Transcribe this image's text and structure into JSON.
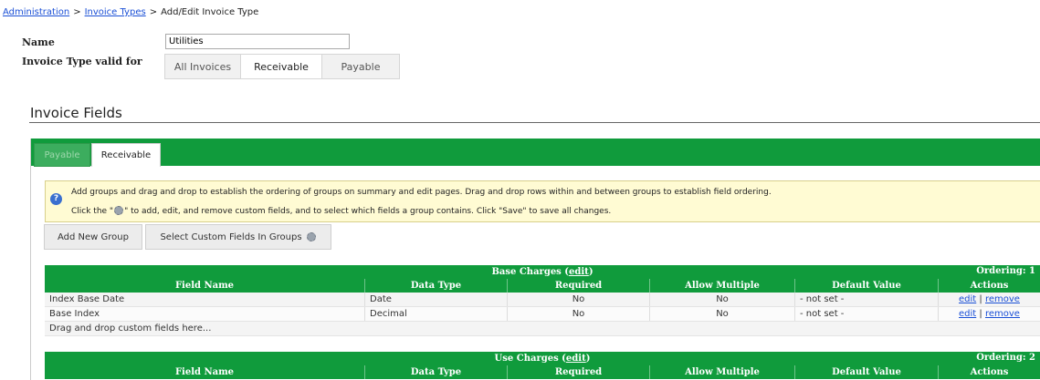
{
  "breadcrumb": {
    "items": [
      "Administration",
      "Invoice Types"
    ],
    "current": "Add/Edit Invoice Type",
    "sep": ">"
  },
  "form": {
    "name_label": "Name",
    "name_value": "Utilities",
    "valid_label": "Invoice Type valid for",
    "valid_options": [
      "All Invoices",
      "Receivable",
      "Payable"
    ],
    "valid_selected": "Receivable"
  },
  "section": {
    "title": "Invoice Fields"
  },
  "tabs": {
    "payable": "Payable",
    "receivable": "Receivable",
    "active": "Receivable"
  },
  "info": {
    "line1": "Add groups and drag and drop to establish the ordering of groups on summary and edit pages. Drag and drop rows within and between groups to establish field ordering.",
    "line2_a": "Click the \"",
    "line2_b": "\" to add, edit, and remove custom fields, and to select which fields a group contains. Click \"Save\" to save all changes."
  },
  "buttons": {
    "add_group": "Add New Group",
    "select_custom": "Select Custom Fields In Groups"
  },
  "columns": [
    "Field Name",
    "Data Type",
    "Required",
    "Allow Multiple",
    "Default Value",
    "Actions"
  ],
  "groups": [
    {
      "title": "Base Charges",
      "edit_link": "edit",
      "ordering": "Ordering: 1",
      "rows": [
        {
          "field": "Index Base Date",
          "type": "Date",
          "required": "No",
          "multiple": "No",
          "default": "- not set -",
          "edit": "edit",
          "sep": "|",
          "remove": "remove"
        },
        {
          "field": "Base Index",
          "type": "Decimal",
          "required": "No",
          "multiple": "No",
          "default": "- not set -",
          "edit": "edit",
          "sep": "|",
          "remove": "remove"
        }
      ],
      "drop_hint": "Drag and drop custom fields here..."
    },
    {
      "title": "Use Charges",
      "edit_link": "edit",
      "ordering": "Ordering: 2"
    }
  ],
  "colors": {
    "accent_green": "#109b3c",
    "info_bg": "#fffbd3",
    "link": "#1a4fd6"
  }
}
